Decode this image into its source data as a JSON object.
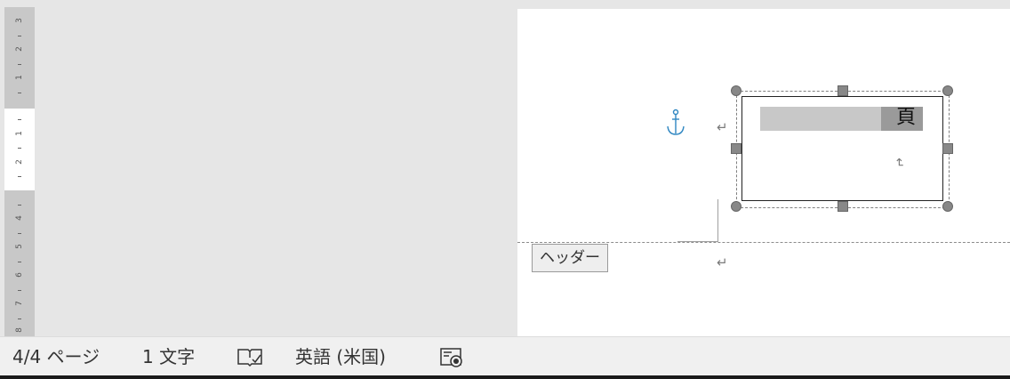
{
  "ruler": {
    "marks": [
      "3",
      "2",
      "1",
      "1",
      "2",
      "4",
      "5",
      "6",
      "7",
      "8"
    ]
  },
  "document": {
    "header_tab_label": "ヘッダー",
    "paragraph_mark": "↵",
    "textbox": {
      "char": "頁",
      "paragraph_mark": "↵"
    }
  },
  "status_bar": {
    "page_count": "4/4 ページ",
    "word_count": "1 文字",
    "proofing_icon": "book-check-icon",
    "language": "英語 (米国)",
    "view_icon": "focus-view-icon"
  }
}
